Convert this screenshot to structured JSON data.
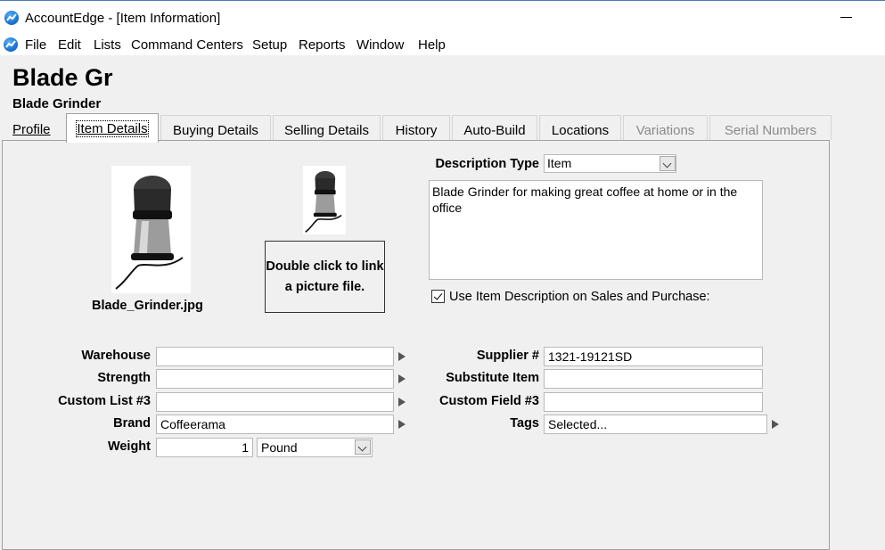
{
  "window": {
    "title": "AccountEdge - [Item Information]"
  },
  "menu": [
    "File",
    "Edit",
    "Lists",
    "Command Centers",
    "Setup",
    "Reports",
    "Window",
    "Help"
  ],
  "item": {
    "name": "Blade Gr",
    "subtitle": "Blade Grinder"
  },
  "tabs": [
    {
      "label": "Profile",
      "state": "normal"
    },
    {
      "label": "Item Details",
      "state": "active"
    },
    {
      "label": "Buying Details",
      "state": "normal"
    },
    {
      "label": "Selling Details",
      "state": "normal"
    },
    {
      "label": "History",
      "state": "normal"
    },
    {
      "label": "Auto-Build",
      "state": "normal"
    },
    {
      "label": "Locations",
      "state": "normal"
    },
    {
      "label": "Variations",
      "state": "disabled"
    },
    {
      "label": "Serial Numbers",
      "state": "disabled"
    }
  ],
  "picture": {
    "filename": "Blade_Grinder.jpg",
    "link_text": "Double click to link a picture file."
  },
  "description": {
    "type_label": "Description Type",
    "type_value": "Item",
    "text": "Blade Grinder for making great coffee at home or in the office",
    "checkbox_label": "Use Item Description on Sales and Purchase:",
    "checkbox_checked": true
  },
  "left_fields": {
    "warehouse": {
      "label": "Warehouse",
      "value": ""
    },
    "strength": {
      "label": "Strength",
      "value": ""
    },
    "custom_list_3": {
      "label": "Custom List #3",
      "value": ""
    },
    "brand": {
      "label": "Brand",
      "value": "Coffeerama"
    },
    "weight": {
      "label": "Weight",
      "value": "1",
      "unit": "Pound"
    }
  },
  "right_fields": {
    "supplier": {
      "label": "Supplier #",
      "value": "1321-19121SD"
    },
    "substitute": {
      "label": "Substitute Item",
      "value": ""
    },
    "custom_field_3": {
      "label": "Custom Field #3",
      "value": ""
    },
    "tags": {
      "label": "Tags",
      "value": "Selected..."
    }
  },
  "colors": {
    "accent": "#1e78d6",
    "panel": "#f0f0f0",
    "disabled_text": "#8a8a8a"
  }
}
